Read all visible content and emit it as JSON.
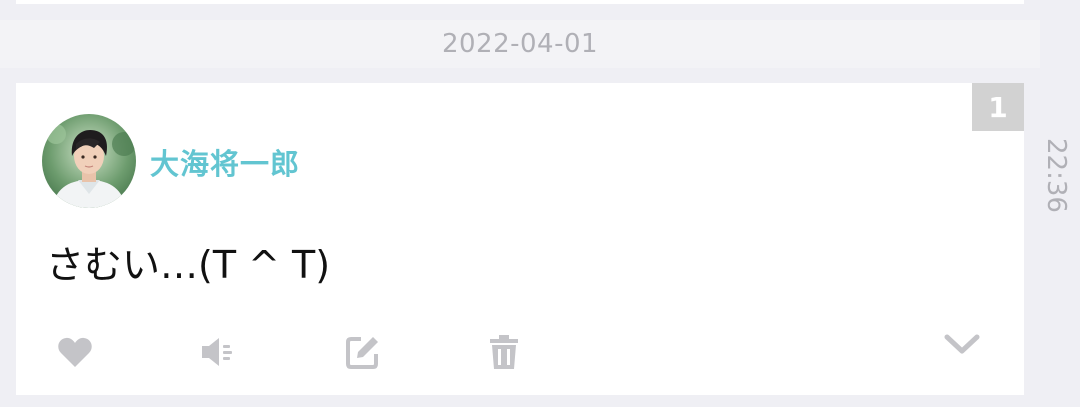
{
  "date_header": "2022-04-01",
  "post": {
    "badge": "1",
    "author": "大海将一郎",
    "text": "さむい…(T ^ T)",
    "time": "22:36"
  },
  "actions": [
    {
      "icon": "heart-icon"
    },
    {
      "icon": "speaker-icon"
    },
    {
      "icon": "edit-icon"
    },
    {
      "icon": "trash-icon"
    },
    {
      "icon": "chevron-down-icon"
    }
  ],
  "colors": {
    "background": "#efeff4",
    "card": "#ffffff",
    "author_name": "#62c5d1",
    "icon_gray": "#c4c4c8",
    "date_text": "#b0b0b6",
    "badge_bg": "#d2d2d2"
  }
}
